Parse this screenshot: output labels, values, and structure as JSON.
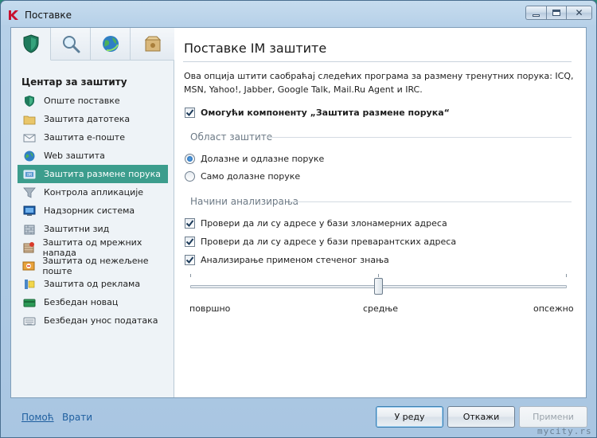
{
  "window": {
    "title": "Поставке"
  },
  "sidebar": {
    "heading": "Центар за заштиту",
    "tabs": [
      {
        "icon": "shield-icon"
      },
      {
        "icon": "magnifier-icon"
      },
      {
        "icon": "globe-icon"
      },
      {
        "icon": "package-icon"
      }
    ],
    "items": [
      {
        "label": "Опште поставке",
        "icon": "shield-icon"
      },
      {
        "label": "Заштита датотека",
        "icon": "folder-icon"
      },
      {
        "label": "Заштита е-поште",
        "icon": "envelope-icon"
      },
      {
        "label": "Web заштита",
        "icon": "globe-icon"
      },
      {
        "label": "Заштита размене порука",
        "icon": "im-icon"
      },
      {
        "label": "Контрола апликације",
        "icon": "funnel-icon"
      },
      {
        "label": "Надзорник система",
        "icon": "monitor-icon"
      },
      {
        "label": "Заштитни зид",
        "icon": "firewall-icon"
      },
      {
        "label": "Заштита од мрежних напада",
        "icon": "network-attack-icon"
      },
      {
        "label": "Заштита од нежељене поште",
        "icon": "antispam-icon"
      },
      {
        "label": "Заштита од реклама",
        "icon": "antibanner-icon"
      },
      {
        "label": "Безбедан новац",
        "icon": "money-card-icon"
      },
      {
        "label": "Безбедан унос података",
        "icon": "keyboard-icon"
      }
    ],
    "active_index": 4
  },
  "content": {
    "title": "Поставке IM заштите",
    "description": "Ова опција штити саобраћај следећих програма за размену тренутних порука: ICQ, MSN, Yahoo!, Jabber, Google Talk, Mail.Ru Agent и IRC.",
    "enable_component": {
      "label": "Омогући компоненту „Заштита размене порука“",
      "checked": true
    },
    "scope": {
      "heading": "Област заштите",
      "options": [
        {
          "label": "Долазне и одлазне поруке",
          "selected": true
        },
        {
          "label": "Само долазне поруке",
          "selected": false
        }
      ]
    },
    "methods": {
      "heading": "Начини анализирања",
      "checks": [
        {
          "label": "Провери да ли су адресе у бази злонамерних адреса",
          "checked": true
        },
        {
          "label": "Провери да ли су адресе у бази преварантских адреса",
          "checked": true
        },
        {
          "label": "Анализирање применом стеченог знања",
          "checked": true
        }
      ],
      "slider": {
        "labels": [
          "површно",
          "средње",
          "опсежно"
        ],
        "value": "средње",
        "position_fraction": 0.5
      }
    }
  },
  "footer": {
    "help_link": "Помоћ",
    "back_link": "Врати",
    "ok_button": "У реду",
    "cancel_button": "Откажи",
    "apply_button": "Примени",
    "apply_enabled": false
  },
  "watermark": "mycity.rs",
  "colors": {
    "accent": "#3c9d8d",
    "link": "#1f5f9f",
    "sidebar_bg": "#eef3f7"
  }
}
